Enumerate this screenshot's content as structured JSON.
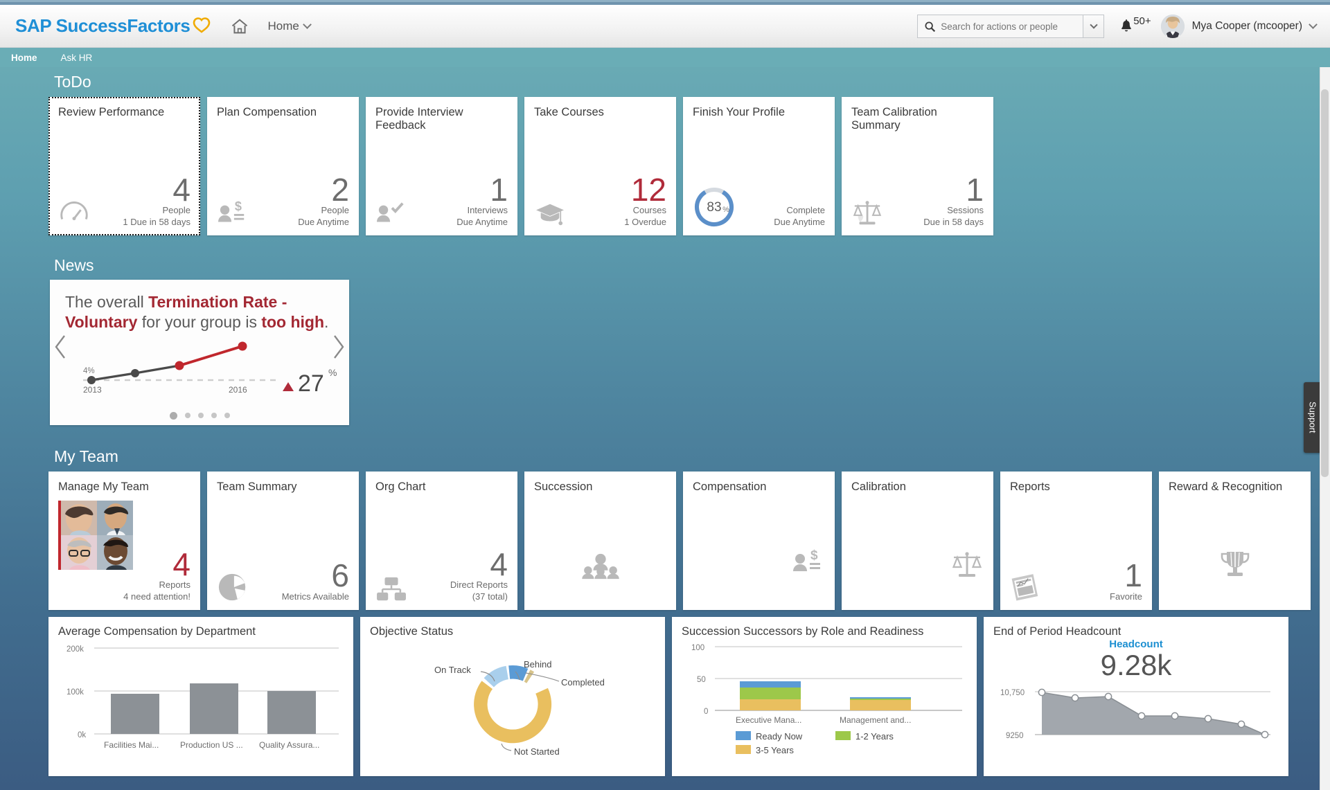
{
  "header": {
    "logo_text": "SAP SuccessFactors",
    "logo_icon": "heart-icon",
    "home_icon": "home-icon",
    "home_menu_label": "Home",
    "search": {
      "placeholder": "Search for actions or people",
      "value": "",
      "icon": "search-icon"
    },
    "notifications": {
      "icon": "bell-icon",
      "count": "50+"
    },
    "user": {
      "name": "Mya Cooper (mcooper)",
      "avatar": "user-avatar"
    }
  },
  "navbar": {
    "items": [
      {
        "label": "Home",
        "active": true
      },
      {
        "label": "Ask HR",
        "active": false
      }
    ]
  },
  "sections": {
    "todo": {
      "title": "ToDo"
    },
    "news": {
      "title": "News"
    },
    "myteam": {
      "title": "My Team"
    }
  },
  "todo_tiles": [
    {
      "title": "Review Performance",
      "icon": "gauge-icon",
      "value": "4",
      "unit": "People",
      "note": "1 Due in 58 days",
      "selected": true,
      "accent": "#6d6d6d"
    },
    {
      "title": "Plan Compensation",
      "icon": "person-dollar-icon",
      "value": "2",
      "unit": "People",
      "note": "Due Anytime",
      "selected": false,
      "accent": "#6d6d6d"
    },
    {
      "title": "Provide Interview Feedback",
      "icon": "person-check-icon",
      "value": "1",
      "unit": "Interviews",
      "note": "Due Anytime",
      "selected": false,
      "accent": "#6d6d6d"
    },
    {
      "title": "Take Courses",
      "icon": "graduation-cap-icon",
      "value": "12",
      "unit": "Courses",
      "note": "1 Overdue",
      "selected": false,
      "accent": "#b02b3a"
    },
    {
      "title": "Finish Your Profile",
      "icon": "progress-donut-icon",
      "value": "",
      "unit": "Complete",
      "note": "Due Anytime",
      "selected": false,
      "percent": "83",
      "percent_symbol": "%",
      "accent": "#6d6d6d"
    },
    {
      "title": "Team Calibration Summary",
      "icon": "scales-icon",
      "value": "1",
      "unit": "Sessions",
      "note": "Due in 58 days",
      "selected": false,
      "accent": "#6d6d6d"
    }
  ],
  "news_card": {
    "headline_parts": [
      {
        "text": "The overall ",
        "bold": false
      },
      {
        "text": "Termination Rate - Voluntary",
        "bold": true
      },
      {
        "text": " for your group is ",
        "bold": false
      },
      {
        "text": "too high",
        "bold": true
      },
      {
        "text": ".",
        "bold": false
      }
    ],
    "prev_icon": "chevron-left-icon",
    "next_icon": "chevron-right-icon",
    "delta_value": "27",
    "delta_symbol": "%",
    "delta_direction_icon": "triangle-up-icon",
    "dots_total": 5,
    "dots_active_index": 0,
    "chart_data": {
      "type": "line",
      "title": "Termination Rate - Voluntary",
      "x": [
        "2013",
        "2014",
        "2015",
        "2016"
      ],
      "values": [
        4,
        5.1,
        6.2,
        8.4
      ],
      "baseline_label": "4%",
      "xlabel": "",
      "ylabel": "",
      "xtick_labels": [
        "2013",
        "2016"
      ],
      "series": [
        {
          "name": "actual",
          "color": "#4a4a4a",
          "points": [
            [
              0,
              4
            ],
            [
              1,
              5.1
            ],
            [
              2,
              6.2
            ]
          ]
        },
        {
          "name": "alert",
          "color": "#c0272d",
          "points": [
            [
              2,
              6.2
            ],
            [
              3,
              8.4
            ]
          ]
        }
      ],
      "grid": false,
      "legend": "none"
    }
  },
  "team_tiles": [
    {
      "title": "Manage My Team",
      "icon": "people-photos-icon",
      "value": "4",
      "unit": "Reports",
      "note": "4 need attention!",
      "accent": "#b02b3a"
    },
    {
      "title": "Team Summary",
      "icon": "pie-chart-icon",
      "value": "6",
      "unit": "Metrics Available",
      "note": "",
      "accent": "#8a8a8a"
    },
    {
      "title": "Org Chart",
      "icon": "org-chart-icon",
      "value": "4",
      "unit": "Direct Reports",
      "note": "(37 total)",
      "accent": "#8a8a8a"
    },
    {
      "title": "Succession",
      "icon": "group-people-icon",
      "value": "",
      "unit": "",
      "note": "",
      "accent": "#8a8a8a"
    },
    {
      "title": "Compensation",
      "icon": "person-dollar-icon",
      "value": "",
      "unit": "",
      "note": "",
      "accent": "#8a8a8a"
    },
    {
      "title": "Calibration",
      "icon": "scales-icon",
      "value": "",
      "unit": "",
      "note": "",
      "accent": "#8a8a8a"
    },
    {
      "title": "Reports",
      "icon": "report-doc-icon",
      "value": "1",
      "unit": "Favorite",
      "note": "",
      "accent": "#8a8a8a"
    },
    {
      "title": "Reward & Recognition",
      "icon": "trophy-icon",
      "value": "",
      "unit": "",
      "note": "",
      "accent": "#8a8a8a"
    }
  ],
  "chart_data": [
    {
      "id": "avg-compensation-by-department",
      "type": "bar",
      "title": "Average Compensation by Department",
      "categories": [
        "Facilities Mai...",
        "Production US ...",
        "Quality Assura..."
      ],
      "values": [
        93000,
        118000,
        99000
      ],
      "ytick_labels": [
        "0k",
        "100k",
        "200k"
      ],
      "ytick_values": [
        0,
        100000,
        200000
      ],
      "ylim": [
        0,
        200000
      ],
      "xlabel": "",
      "ylabel": "",
      "bar_color": "#8c9196",
      "grid": true,
      "legend": "none"
    },
    {
      "id": "objective-status",
      "type": "pie",
      "title": "Objective Status",
      "labels": [
        "On Track",
        "Behind",
        "Completed",
        "Not Started"
      ],
      "values": [
        7,
        5,
        1,
        87
      ],
      "colors": [
        "#a9cfec",
        "#5b9bd5",
        "#d8c48a",
        "#e9bf5f"
      ],
      "donut": true,
      "legend": "callout-labels"
    },
    {
      "id": "succession-successors-by-role-and-readiness",
      "type": "bar",
      "stacked": true,
      "title": "Succession Successors by Role and Readiness",
      "categories": [
        "Executive Mana...",
        "Management and..."
      ],
      "series": [
        {
          "name": "3-5 Years",
          "color": "#e9bf5f",
          "values": [
            17,
            16
          ]
        },
        {
          "name": "1-2 Years",
          "color": "#9dc84a",
          "values": [
            18,
            1
          ]
        },
        {
          "name": "Ready Now",
          "color": "#5b9bd5",
          "values": [
            10,
            1
          ]
        }
      ],
      "ytick_labels": [
        "0",
        "50",
        "100"
      ],
      "ytick_values": [
        0,
        50,
        100
      ],
      "ylim": [
        0,
        100
      ],
      "xlabel": "",
      "ylabel": "",
      "grid": true,
      "legend": "bottom"
    },
    {
      "id": "end-of-period-headcount",
      "type": "area",
      "title": "End of Period Headcount",
      "kpi_name": "Headcount",
      "kpi_value": "9.28k",
      "x": [
        "1",
        "2",
        "3",
        "4",
        "5",
        "6",
        "7",
        "8"
      ],
      "values": [
        10740,
        10600,
        10640,
        10030,
        10030,
        9960,
        9790,
        9280
      ],
      "ytick_labels": [
        "9250",
        "10,750"
      ],
      "ytick_values": [
        9250,
        10750
      ],
      "ylim": [
        9250,
        10750
      ],
      "xlabel": "",
      "ylabel": "",
      "area_color": "#9aa0a6",
      "line_color": "#8a8f94",
      "marker": "open-circle",
      "grid": true,
      "legend": "none"
    }
  ],
  "right_rail": {
    "support_label": "Support"
  }
}
